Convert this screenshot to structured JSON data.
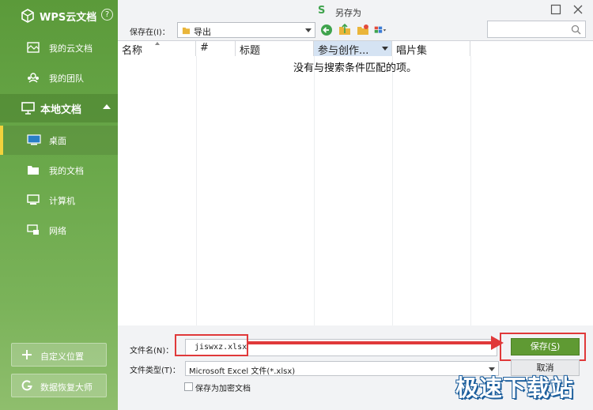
{
  "sidebar": {
    "title": "WPS云文档",
    "help": "?",
    "cloud_items": [
      {
        "label": "我的云文档",
        "icon": "cloud-doc-icon"
      },
      {
        "label": "我的团队",
        "icon": "team-icon"
      }
    ],
    "local_section": {
      "label": "本地文档",
      "icon": "computer-icon"
    },
    "local_items": [
      {
        "label": "桌面",
        "icon": "desktop-icon",
        "active": true
      },
      {
        "label": "我的文档",
        "icon": "folder-icon"
      },
      {
        "label": "计算机",
        "icon": "monitor-icon"
      },
      {
        "label": "网络",
        "icon": "network-icon"
      }
    ],
    "custom_location": "自定义位置",
    "data_recovery": "数据恢复大师"
  },
  "dialog": {
    "logo": "S",
    "title": "另存为",
    "save_in_label": "保存在(I)：",
    "current_folder": "导出",
    "columns": [
      "名称",
      "#",
      "标题",
      "参与创作...",
      "唱片集"
    ],
    "empty_message": "没有与搜索条件匹配的项。",
    "filename_label": "文件名(N)：",
    "filename_value": "jiswxz.xlsx",
    "filetype_label": "文件类型(T)：",
    "filetype_value": "Microsoft Excel 文件(*.xlsx)",
    "encrypt_label": "保存为加密文档",
    "encrypt_checked": false,
    "save_button": "保存",
    "save_button_key": "S",
    "cancel_button": "取消"
  },
  "colors": {
    "accent_green": "#5f9a33",
    "highlight_red": "#e0393a"
  },
  "watermark": "极速下载站"
}
